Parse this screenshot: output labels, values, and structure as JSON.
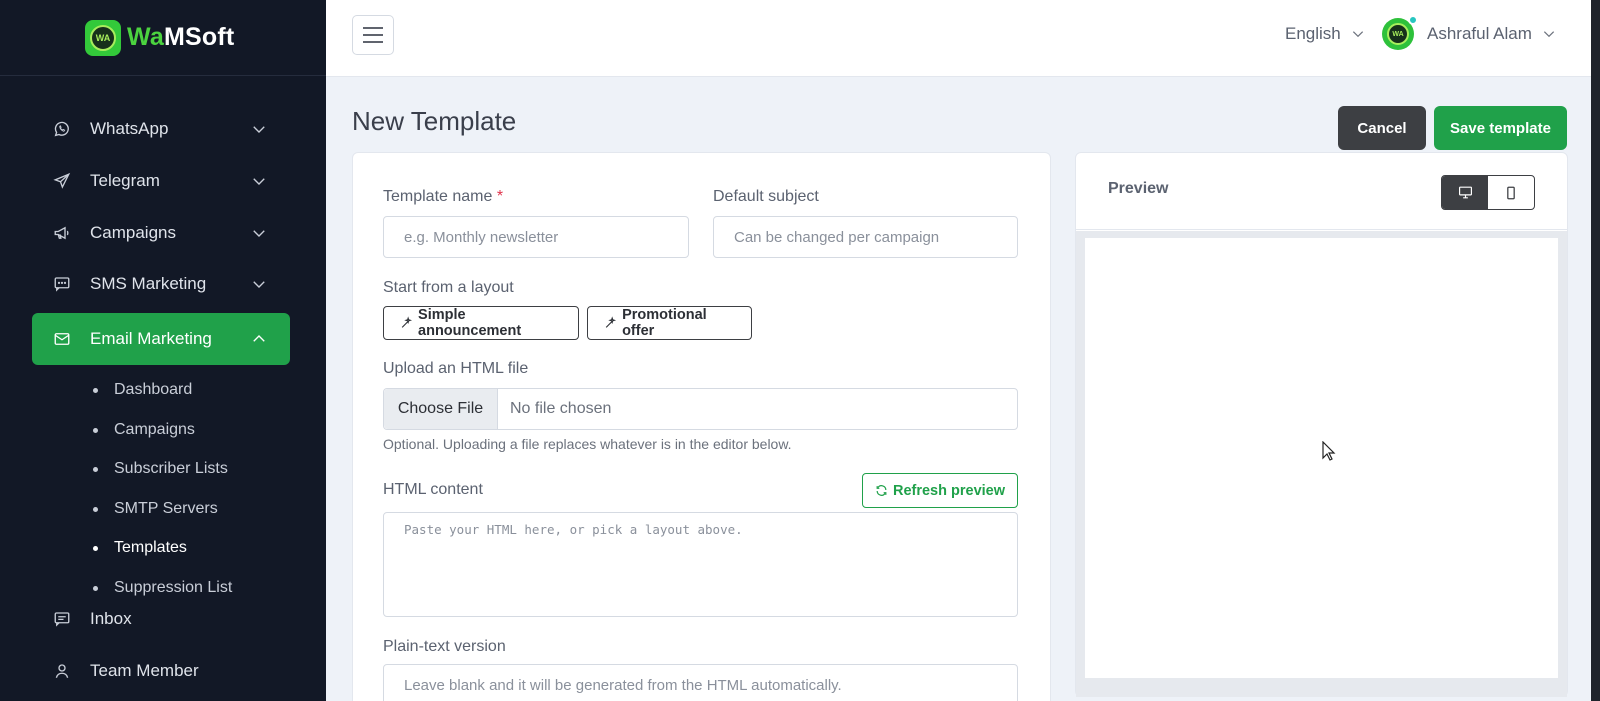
{
  "brand": {
    "name_part1": "Wa",
    "name_part2": "MSoft",
    "logo_text": "WA"
  },
  "sidebar": {
    "items": [
      {
        "label": "WhatsApp",
        "icon": "whatsapp-icon"
      },
      {
        "label": "Telegram",
        "icon": "telegram-icon"
      },
      {
        "label": "Campaigns",
        "icon": "megaphone-icon"
      },
      {
        "label": "SMS Marketing",
        "icon": "sms-icon"
      },
      {
        "label": "Email Marketing",
        "icon": "envelope-icon",
        "active": true
      },
      {
        "label": "Inbox",
        "icon": "inbox-icon"
      },
      {
        "label": "Team Member",
        "icon": "user-icon"
      }
    ],
    "email_sub": [
      "Dashboard",
      "Campaigns",
      "Subscriber Lists",
      "SMTP Servers",
      "Templates",
      "Suppression List"
    ],
    "current_sub": "Templates"
  },
  "topbar": {
    "language": "English",
    "user_name": "Ashraful Alam"
  },
  "page": {
    "title": "New Template",
    "cancel_label": "Cancel",
    "save_label": "Save template"
  },
  "form": {
    "template_name_label": "Template name",
    "template_name_required": "*",
    "template_name_placeholder": "e.g. Monthly newsletter",
    "default_subject_label": "Default subject",
    "default_subject_placeholder": "Can be changed per campaign",
    "layout_label": "Start from a layout",
    "layout_buttons": [
      "Simple announcement",
      "Promotional offer"
    ],
    "upload_label": "Upload an HTML file",
    "choose_file_label": "Choose File",
    "no_file_label": "No file chosen",
    "upload_help": "Optional. Uploading a file replaces whatever is in the editor below.",
    "html_label": "HTML content",
    "refresh_label": "Refresh preview",
    "html_placeholder": "Paste your HTML here, or pick a layout above.",
    "plaintext_label": "Plain-text version",
    "plaintext_placeholder": "Leave blank and it will be generated from the HTML automatically."
  },
  "preview": {
    "title": "Preview",
    "device_modes": [
      "desktop",
      "mobile"
    ],
    "selected_mode": "desktop"
  },
  "colors": {
    "sidebar_bg": "#121826",
    "accent": "#20a14a",
    "dark_button": "#3d3f43",
    "page_bg": "#eef2f8",
    "required": "#e0334b"
  }
}
